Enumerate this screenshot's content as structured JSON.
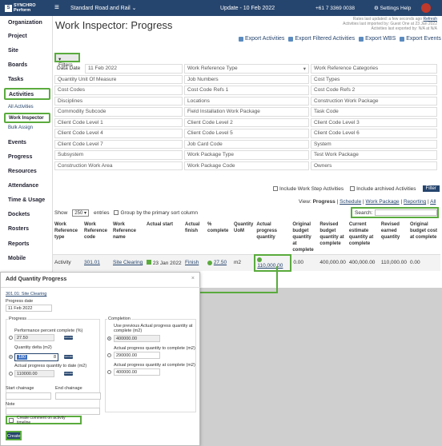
{
  "topbar": {
    "logo_mark": "S",
    "logo_text_1": "SYNCHRO",
    "logo_text_2": "Perform",
    "project": "Standard Road and Rail",
    "project_arrow": "⌄",
    "update": "Update - 10 Feb 2022",
    "phone": "+61 7 3369 0038",
    "settings": "Settings",
    "help": "Help"
  },
  "sidebar": {
    "items": [
      "Organization",
      "Project",
      "Site",
      "Boards",
      "Tasks",
      "Activities",
      "Events",
      "Progress",
      "Resources",
      "Attendance",
      "Time & Usage",
      "Dockets",
      "Rosters",
      "Reports",
      "Mobile"
    ],
    "subitems": [
      "All Activities",
      "Work Inspector",
      "Bulk Assign"
    ]
  },
  "main": {
    "title": "Work Inspector: Progress",
    "rates_line1": "Rates last updated: a few seconds ago",
    "rates_refresh": "Refresh",
    "rates_line2": "Activities last imported by: Guest One at 23 Jan 2022",
    "rates_line3": "Activities last exported by: N/A at N/A",
    "exports": [
      "Export Activities",
      "Export Filtered Activities",
      "Export WBS",
      "Export Events"
    ],
    "filters_label": "▾ Filters"
  },
  "filters": {
    "data_date_label": "Data Date",
    "data_date_value": "11 Feb 2022",
    "fields": [
      "Work Reference Type",
      "Work Reference Categories",
      "Quantity Unit Of Measure",
      "Job Numbers",
      "Cost Types",
      "Cost Codes",
      "Cost Code Refs 1",
      "Cost Code Refs 2",
      "Disciplines",
      "Locations",
      "Construction Work Package",
      "Commodity Subcode",
      "Field Installation Work Package",
      "Task Code",
      "Client Code Level 1",
      "Client Code Level 2",
      "Client Code Level 3",
      "Client Code Level 4",
      "Client Code Level 5",
      "Client Code Level 6",
      "Client Code Level 7",
      "Job Card Code",
      "System",
      "Subsystem",
      "Work Package Type",
      "Test Work Package",
      "Construction Work Area",
      "Work Package Code",
      "Owners"
    ],
    "include_steps": "Include Work Step Activities",
    "include_archived": "Include archived Activities",
    "filter_button": "Filter"
  },
  "listing": {
    "show_label": "Show",
    "show_value": "250",
    "entries_label": "entries",
    "group_label": "Group by the primary sort column",
    "view_label": "View:",
    "views": [
      "Progress",
      "Schedule",
      "Work Package",
      "Reporting",
      "All"
    ],
    "search_label": "Search:"
  },
  "table": {
    "headers": [
      "Work Reference type",
      "Work Reference code",
      "Work Reference name",
      "Actual start",
      "Actual finish",
      "% complete",
      "Quantity UoM",
      "Actual progress quantity",
      "Original budget quantity at complete",
      "Revised budget quantity at complete",
      "Current estimate quantity at complete",
      "Revised earned quantity",
      "Original budget cost at complete"
    ],
    "rows": [
      [
        "Activity",
        "301.01",
        "Site Clearing",
        "23 Jan 2022",
        "Finish",
        "27.50",
        "m2",
        "110,000.00",
        "0.00",
        "400,000.00",
        "400,000.00",
        "110,000.00",
        "0.00"
      ]
    ]
  },
  "dialog": {
    "title": "Add Quantity Progress",
    "close": "×",
    "activity": "301.01: Site Clearing",
    "progress_date_label": "Progress date",
    "progress_date_value": "11 Feb 2022",
    "progress_legend": "Progress",
    "perf_label": "Performance percent complete (%)",
    "perf_value": "27.50",
    "qty_delta_label": "Quantity delta (m2)",
    "qty_delta_value": "180",
    "qty_delta_tail": "8",
    "actual_todate_label": "Actual progress quantity to date (m2)",
    "actual_todate_value": "110000.00",
    "completion_legend": "Completion",
    "use_prev_label": "Use previous Actual progress quantity at complete (m2)",
    "use_prev_value": "400000.00",
    "actual_complete_label": "Actual progress quantity to complete (m2)",
    "actual_complete_value": "290000.00",
    "actual_at_complete_label": "Actual progress quantity at complete (m2)",
    "actual_at_complete_value": "400000.00",
    "start_chainage": "Start chainage",
    "end_chainage": "End chainage",
    "note": "Note",
    "create_comment": "Create comment on activity timeline",
    "create_button": "Create",
    "pill": "calculate"
  },
  "colors": {
    "brand": "#26456e",
    "highlight": "#5aab3d"
  }
}
